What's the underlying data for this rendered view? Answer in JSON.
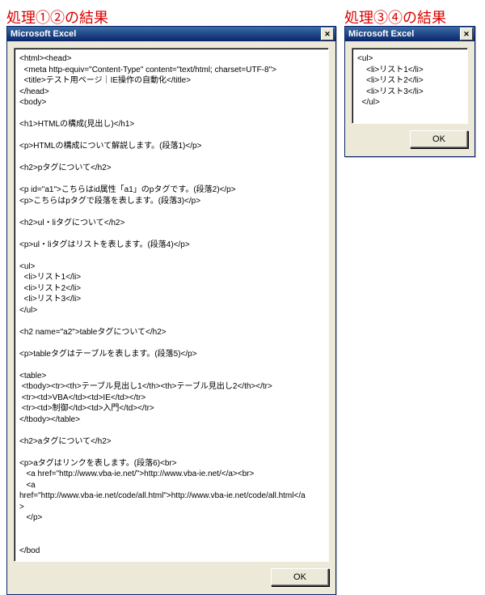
{
  "labels": {
    "left": "処理①②の結果",
    "right": "処理③④の結果"
  },
  "dialogs": {
    "big": {
      "title": "Microsoft Excel",
      "ok": "OK",
      "body": "<html><head>\n  <meta http-equiv=\"Content-Type\" content=\"text/html; charset=UTF-8\">\n  <title>テスト用ページ｜IE操作の自動化</title>\n</head>\n<body>\n\n<h1>HTMLの構成(見出し)</h1>\n\n<p>HTMLの構成について解説します。(段落1)</p>\n\n<h2>pタグについて</h2>\n\n<p id=\"a1\">こちらはid属性「a1」のpタグです。(段落2)</p>\n<p>こちらはpタグで段落を表します。(段落3)</p>\n\n<h2>ul・liタグについて</h2>\n\n<p>ul・liタグはリストを表します。(段落4)</p>\n\n<ul>\n  <li>リスト1</li>\n  <li>リスト2</li>\n  <li>リスト3</li>\n</ul>\n\n<h2 name=\"a2\">tableタグについて</h2>\n\n<p>tableタグはテーブルを表します。(段落5)</p>\n\n<table>\n <tbody><tr><th>テーブル見出し1</th><th>テーブル見出し2</th></tr>\n <tr><td>VBA</td><td>IE</td></tr>\n <tr><td>制御</td><td>入門</td></tr>\n</tbody></table>\n\n<h2>aタグについて</h2>\n\n<p>aタグはリンクを表します。(段落6)<br>\n   <a href=\"http://www.vba-ie.net/\">http://www.vba-ie.net/</a><br>\n   <a\nhref=\"http://www.vba-ie.net/code/all.html\">http://www.vba-ie.net/code/all.html</a\n>\n   </p>\n\n\n</bod"
    },
    "small": {
      "title": "Microsoft Excel",
      "ok": "OK",
      "body": "<ul>\n    <li>リスト1</li>\n    <li>リスト2</li>\n    <li>リスト3</li>\n  </ul>"
    }
  }
}
